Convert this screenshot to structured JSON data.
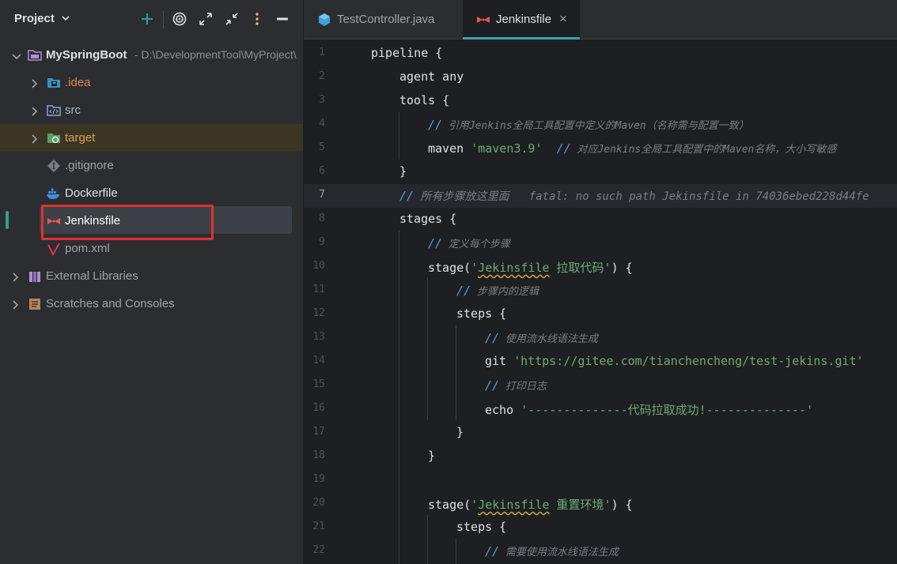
{
  "project": {
    "title": "Project",
    "tree": [
      {
        "label": "MySpringBoot",
        "path": "- D:\\DevelopmentTool\\MyProject\\",
        "icon": "folder-module-icon",
        "expanded": true
      },
      {
        "label": ".idea",
        "icon": "idea-folder-icon",
        "expanded": false
      },
      {
        "label": "src",
        "icon": "source-folder-icon",
        "expanded": false
      },
      {
        "label": "target",
        "icon": "excluded-folder-icon",
        "expanded": false
      },
      {
        "label": ".gitignore",
        "icon": "git-file-icon"
      },
      {
        "label": "Dockerfile",
        "icon": "docker-icon"
      },
      {
        "label": "Jenkinsfile",
        "icon": "jenkins-icon",
        "selected": true
      },
      {
        "label": "pom.xml",
        "icon": "maven-icon"
      },
      {
        "label": "External Libraries",
        "icon": "library-icon",
        "expanded": false
      },
      {
        "label": "Scratches and Consoles",
        "icon": "scratches-icon",
        "expanded": false
      }
    ]
  },
  "tabs": [
    {
      "label": "TestController.java",
      "icon": "java-class-icon",
      "active": false
    },
    {
      "label": "Jenkinsfile",
      "icon": "jenkins-icon",
      "active": true,
      "close": "×"
    }
  ],
  "editor": {
    "current_line": 7,
    "lines": [
      {
        "n": "1"
      },
      {
        "n": "2"
      },
      {
        "n": "3"
      },
      {
        "n": "4"
      },
      {
        "n": "5"
      },
      {
        "n": "6"
      },
      {
        "n": "7"
      },
      {
        "n": "8"
      },
      {
        "n": "9"
      },
      {
        "n": "10"
      },
      {
        "n": "11"
      },
      {
        "n": "12"
      },
      {
        "n": "13"
      },
      {
        "n": "14"
      },
      {
        "n": "15"
      },
      {
        "n": "16"
      },
      {
        "n": "17"
      },
      {
        "n": "18"
      },
      {
        "n": "19"
      },
      {
        "n": "20"
      },
      {
        "n": "21"
      },
      {
        "n": "22"
      }
    ],
    "code": {
      "l1": "pipeline {",
      "l2": "agent any",
      "l3": "tools {",
      "l4_slash": "//",
      "l4_text": " 引用Jenkins全局工具配置中定义的Maven（名称需与配置一致）",
      "l5_kw": "maven ",
      "l5_str": "'maven3.9'",
      "l5_slash": "  //",
      "l5_text": " 对应Jenkins全局工具配置中的Maven名称，大小写敏感",
      "l6": "}",
      "l7_slash": "//",
      "l7_text": " 所有步骤放这里面   fatal: no such path Jekinsfile in 74036ebed228d44fe",
      "l8": "stages {",
      "l9_slash": "//",
      "l9_text": " 定义每个步骤",
      "l10_kw": "stage(",
      "l10_q1": "'",
      "l10_word": "Jekinsfile",
      "l10_rest": " 拉取代码'",
      "l10_end": ") {",
      "l11_slash": "//",
      "l11_text": " 步骤内的逻辑",
      "l12": "steps {",
      "l13_slash": "//",
      "l13_text": " 使用流水线语法生成",
      "l14_kw": "git ",
      "l14_str": "'https://gitee.com/tianchencheng/test-jekins.git'",
      "l15_slash": "//",
      "l15_text": " 打印日志",
      "l16_kw": "echo ",
      "l16_str": "'--------------代码拉取成功!--------------'",
      "l17": "}",
      "l18": "}",
      "l20_kw": "stage(",
      "l20_q1": "'",
      "l20_word": "Jekinsfile",
      "l20_rest": " 重置环境'",
      "l20_end": ") {",
      "l21": "steps {",
      "l22_slash": "//",
      "l22_text": " 需要使用流水线语法生成"
    }
  },
  "colors": {
    "accent": "#3ba2ab",
    "selection_box": "#e03030",
    "excluded_folder_bg": "#3d3523"
  }
}
